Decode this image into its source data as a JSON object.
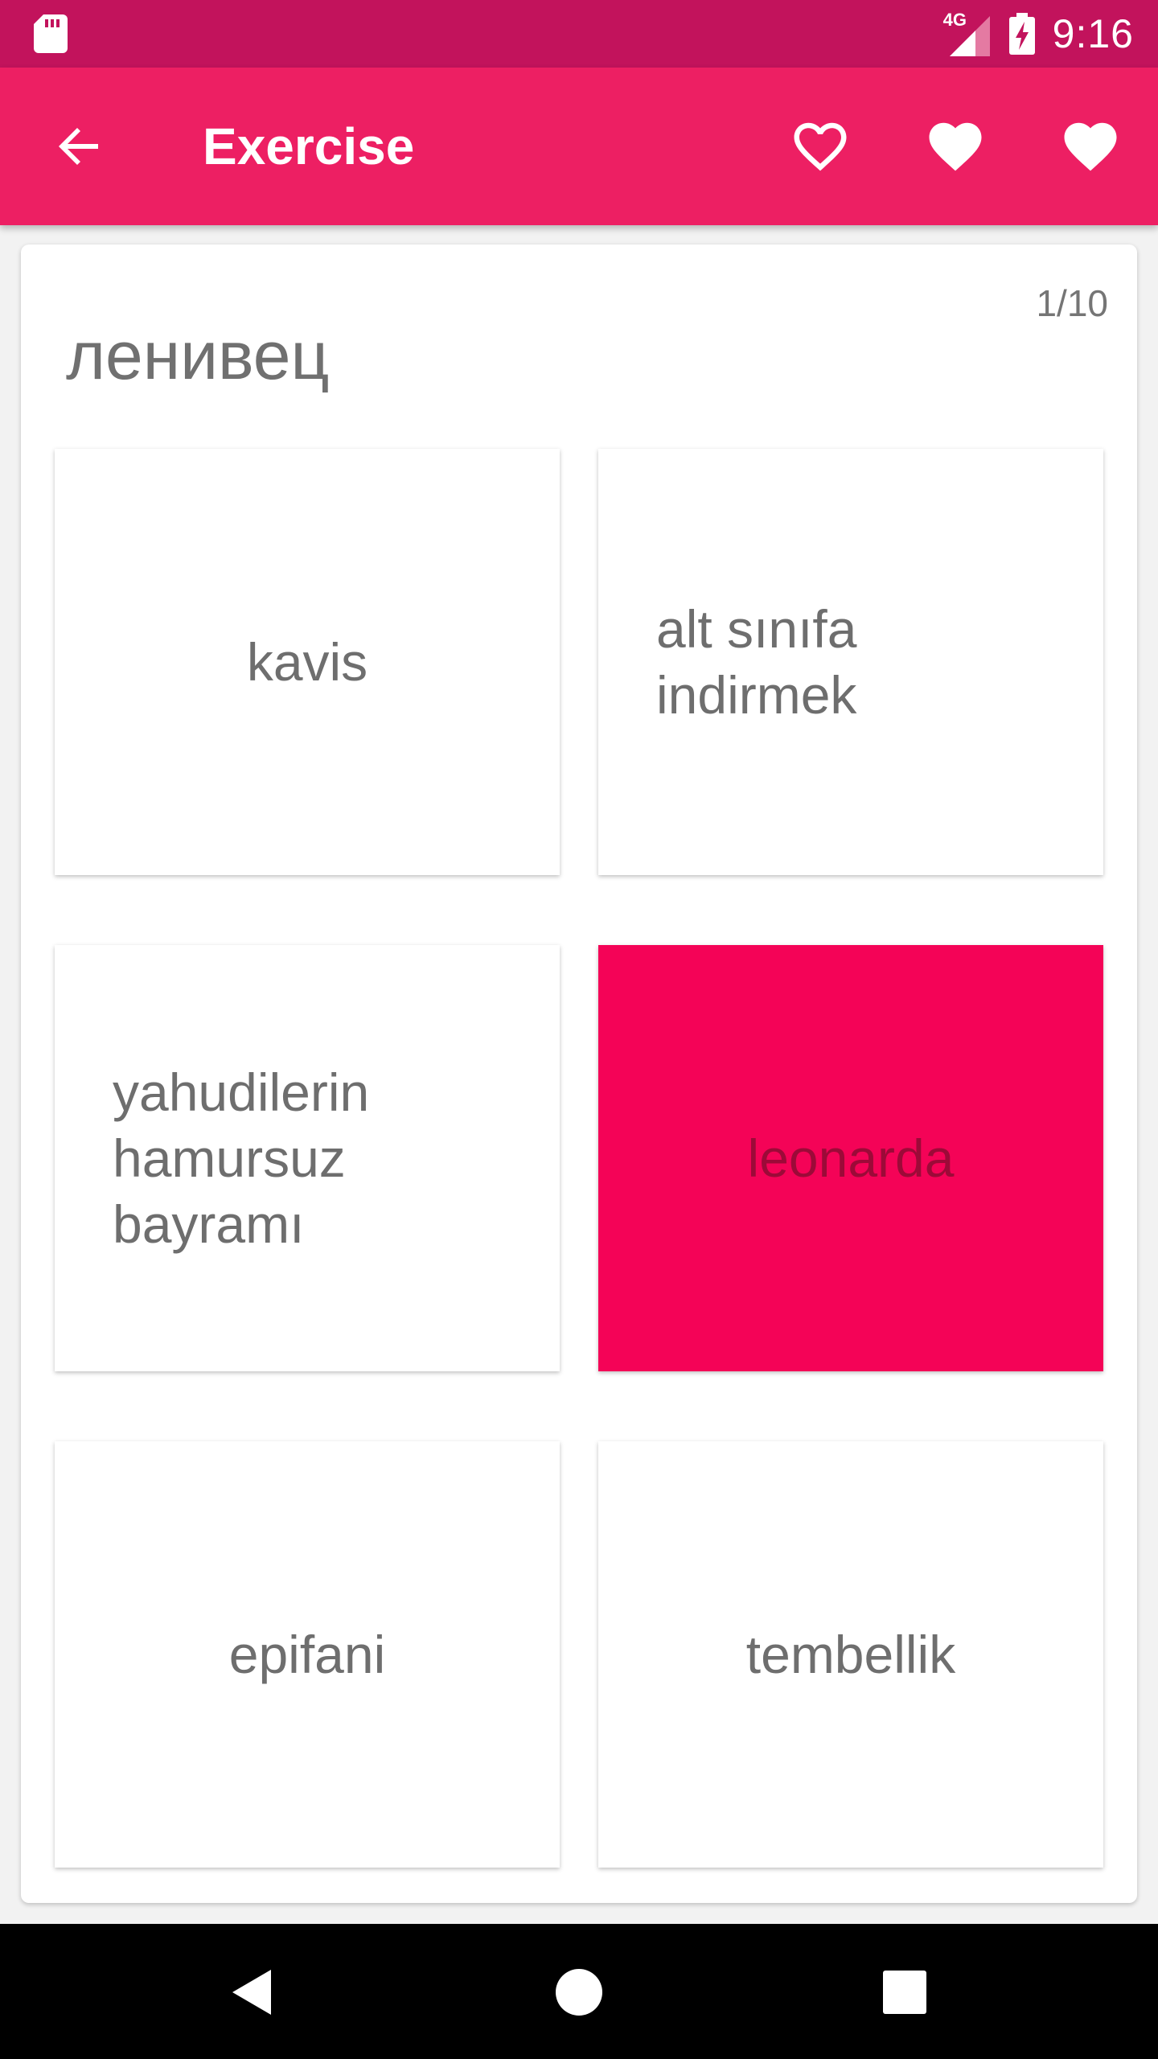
{
  "status_bar": {
    "time": "9:16",
    "network": "4G"
  },
  "app_bar": {
    "title": "Exercise"
  },
  "exercise": {
    "counter": "1/10",
    "word": "ленивец",
    "options": [
      {
        "text": "kavis"
      },
      {
        "text": "alt sınıfa\nindirmek"
      },
      {
        "text": "yahudilerin\nhamursuz\nbayramı"
      },
      {
        "text": "leonarda"
      },
      {
        "text": "epifani"
      },
      {
        "text": "tembellik"
      }
    ]
  },
  "colors": {
    "status_bar": "#c2135c",
    "app_bar": "#ed1f63",
    "selected_option": "#f40357",
    "text": "#6e6e6e"
  },
  "icons": {
    "back": "arrow-left-icon",
    "favorite_1": "heart-outline-icon",
    "favorite_2": "heart-filled-icon",
    "favorite_3": "heart-filled-icon"
  }
}
